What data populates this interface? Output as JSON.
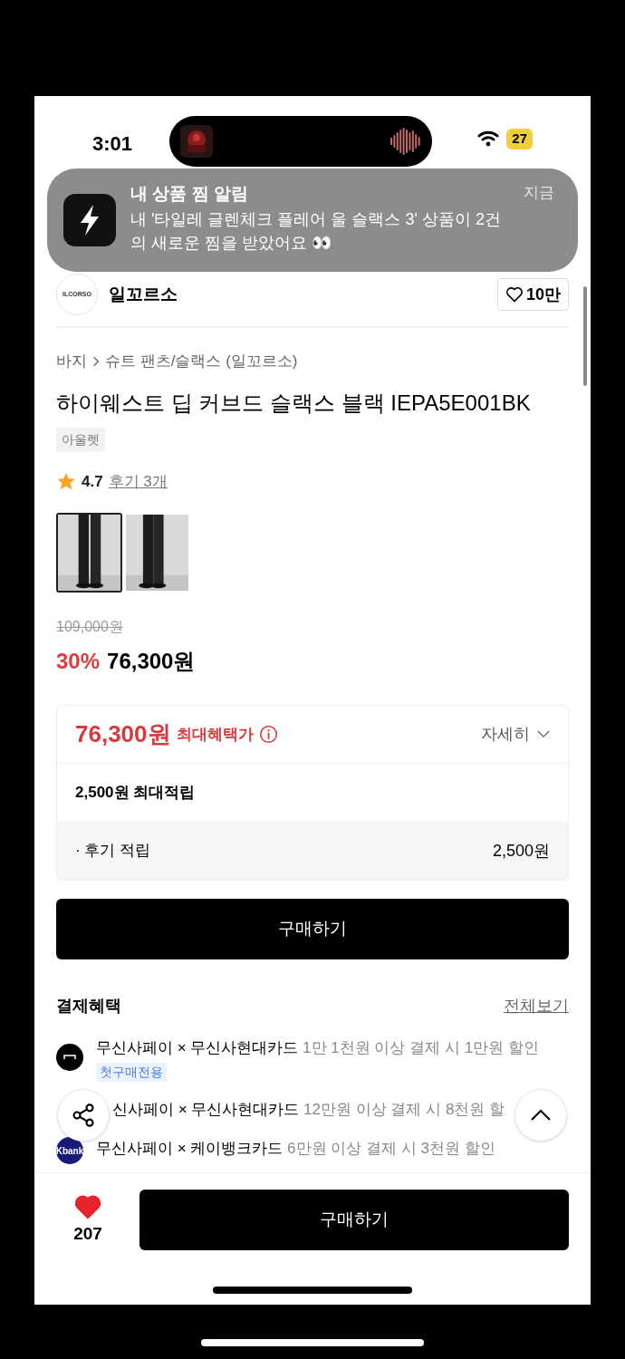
{
  "status_bar": {
    "time": "3:01",
    "battery": "27"
  },
  "notification": {
    "title": "내 상품 찜 알림",
    "time": "지금",
    "message": "내 '타일레 글렌체크 플레어 울 슬랙스 3' 상품이 2건의 새로운 찜을 받았어요 👀"
  },
  "seller": {
    "logo": "ILCORSO",
    "name": "일꼬르소",
    "likes": "10만"
  },
  "breadcrumb": [
    "바지",
    "슈트 팬츠/슬랙스 (일꼬르소)"
  ],
  "product": {
    "title": "하이웨스트 딥 커브드 슬랙스 블랙 IEPA5E001BK",
    "tag": "아울렛",
    "rating": "4.7",
    "reviews": "후기 3개"
  },
  "thumbnails": [
    {
      "kind": "picture",
      "selected": true
    },
    {
      "kind": "picture",
      "selected": false
    }
  ],
  "price": {
    "original": "109,000원",
    "discount": "30%",
    "sale": "76,300원"
  },
  "benefit": {
    "price": "76,300원",
    "label": "최대혜택가",
    "details": "자세히",
    "points_title": "2,500원 최대적립",
    "points": [
      {
        "label": "· 후기 적립",
        "amount": "2,500원"
      }
    ]
  },
  "buy_button": "구매하기",
  "payment": {
    "title": "결제혜택",
    "view_all": "전체보기",
    "rows": [
      {
        "kind": "musinsa",
        "brand": "무신사페이 × 무신사현대카드",
        "desc": "1만 1천원 이상 결제 시 1만원 할인",
        "badge": "첫구매전용"
      },
      {
        "kind": "hidden",
        "brand": "신사페이 × 무신사현대카드",
        "desc": "12만원 이상 결제 시 8천원 할"
      },
      {
        "kind": "kbank",
        "logo": "Kbank",
        "brand": "무신사페이 × 케이뱅크카드",
        "desc": "6만원 이상 결제 시 3천원 할인"
      }
    ]
  },
  "bottom_bar": {
    "liked": true,
    "likes": "207",
    "buy_button": "구매하기"
  }
}
